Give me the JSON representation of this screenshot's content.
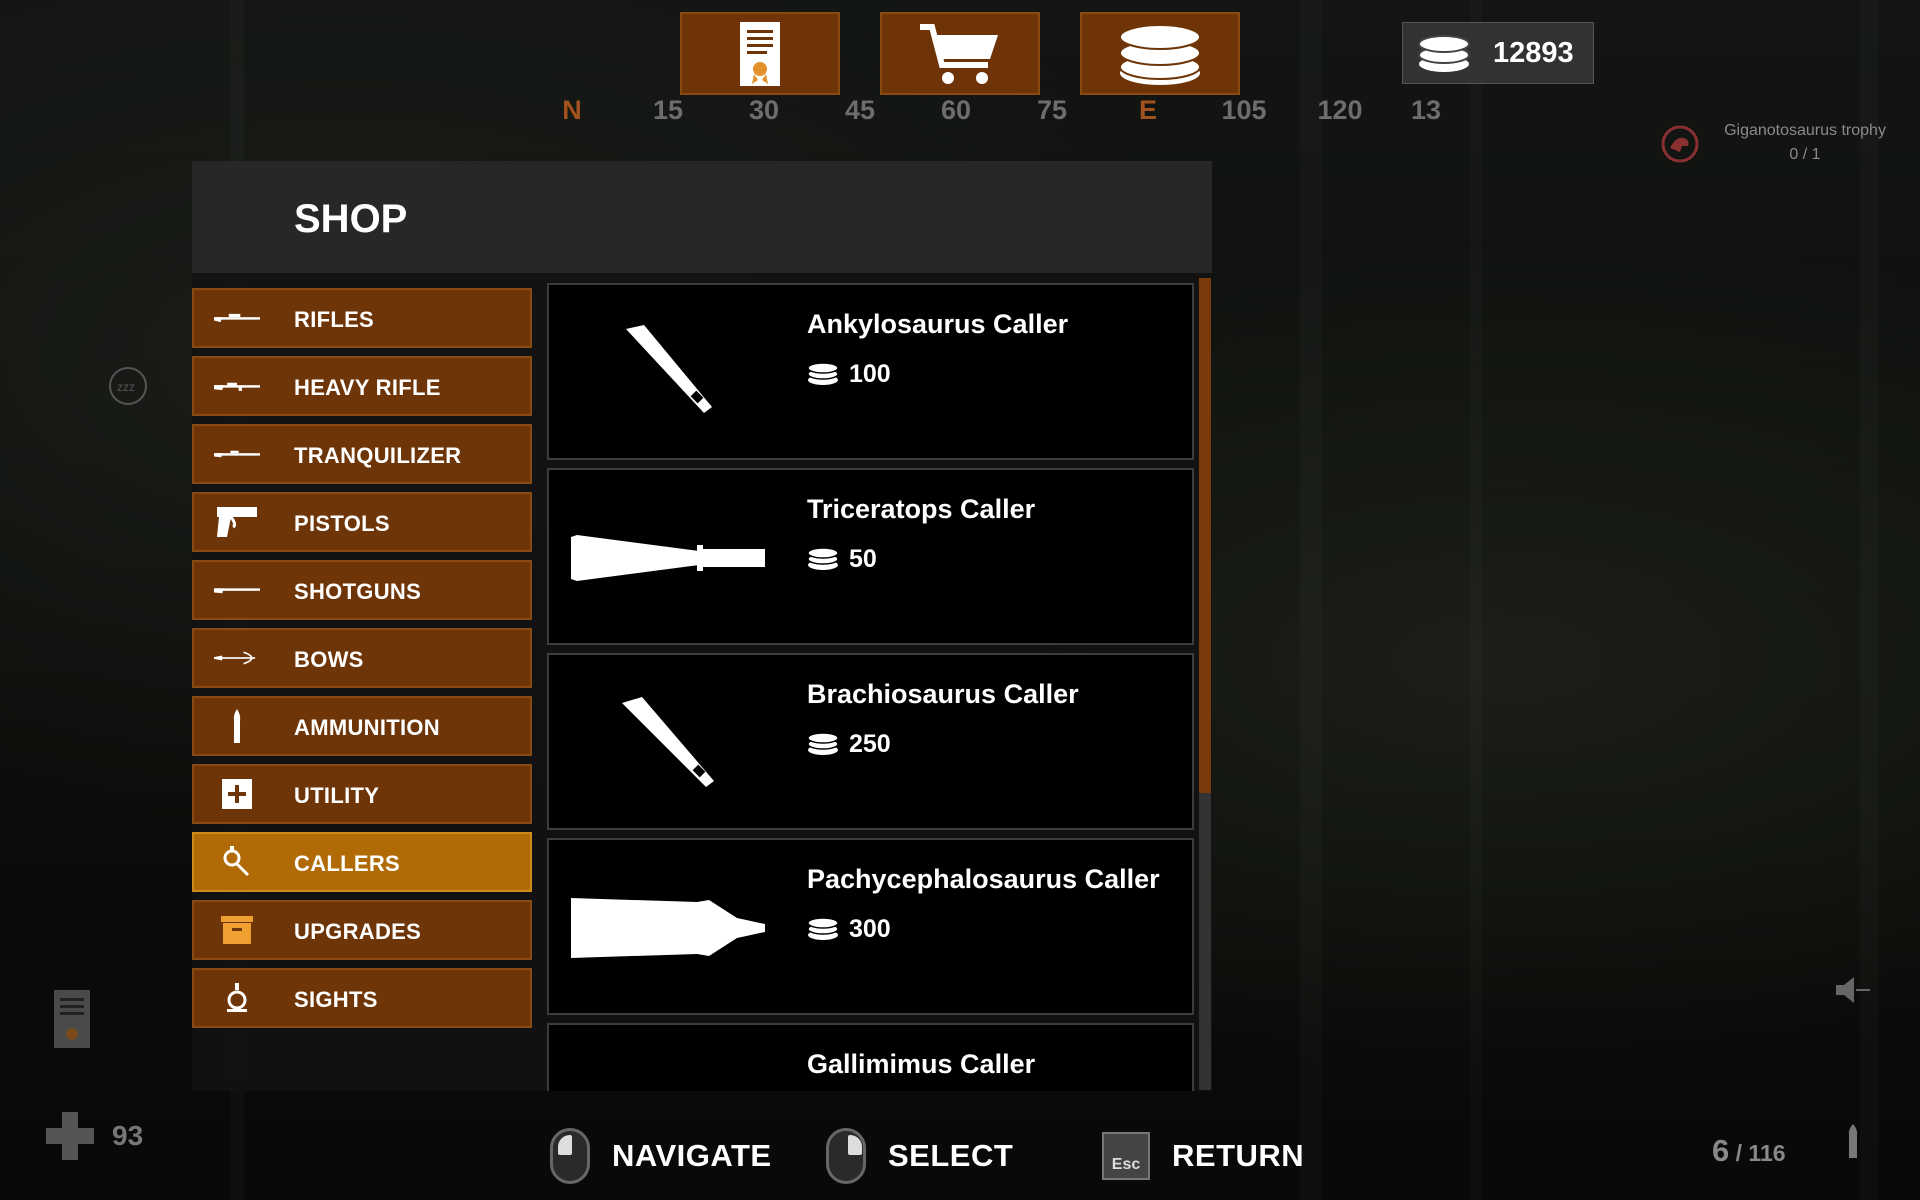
{
  "top_tabs": [
    {
      "name": "contracts",
      "icon": "contract-certificate-icon"
    },
    {
      "name": "shop",
      "icon": "shopping-cart-icon"
    },
    {
      "name": "currency",
      "icon": "coin-stack-icon"
    }
  ],
  "currency": {
    "icon": "coin-stack-icon",
    "value": "12893"
  },
  "compass": {
    "marks": [
      "N",
      "15",
      "30",
      "45",
      "60",
      "75",
      "E",
      "105",
      "120",
      "13"
    ]
  },
  "trophy": {
    "name": "Giganotosaurus trophy",
    "progress": "0 / 1"
  },
  "shop": {
    "title": "SHOP",
    "categories": [
      {
        "label": "RIFLES",
        "icon": "rifle-icon",
        "active": false
      },
      {
        "label": "HEAVY RIFLE",
        "icon": "heavy-rifle-icon",
        "active": false
      },
      {
        "label": "TRANQUILIZER",
        "icon": "tranquilizer-rifle-icon",
        "active": false
      },
      {
        "label": "PISTOLS",
        "icon": "pistol-icon",
        "active": false
      },
      {
        "label": "SHOTGUNS",
        "icon": "shotgun-icon",
        "active": false
      },
      {
        "label": "BOWS",
        "icon": "bow-icon",
        "active": false
      },
      {
        "label": "AMMUNITION",
        "icon": "bullet-icon",
        "active": false
      },
      {
        "label": "UTILITY",
        "icon": "medkit-plus-icon",
        "active": false
      },
      {
        "label": "CALLERS",
        "icon": "caller-horn-icon",
        "active": true
      },
      {
        "label": "UPGRADES",
        "icon": "upgrade-box-icon",
        "active": false
      },
      {
        "label": "SIGHTS",
        "icon": "scope-sight-icon",
        "active": false
      }
    ],
    "items": [
      {
        "name": "Ankylosaurus Caller",
        "price": "100",
        "art": "horn-caller-art"
      },
      {
        "name": "Triceratops Caller",
        "price": "50",
        "art": "long-horn-caller-art"
      },
      {
        "name": "Brachiosaurus Caller",
        "price": "250",
        "art": "horn-caller-art"
      },
      {
        "name": "Pachycephalosaurus Caller",
        "price": "300",
        "art": "tube-caller-art"
      },
      {
        "name": "Gallimimus Caller",
        "price": "",
        "art": ""
      }
    ]
  },
  "hints": [
    {
      "label": "NAVIGATE",
      "key": "mouse-left-icon"
    },
    {
      "label": "SELECT",
      "key": "mouse-right-icon"
    },
    {
      "label": "RETURN",
      "key": "Esc"
    }
  ],
  "hud": {
    "health": "93",
    "ammo_current": "6",
    "ammo_total": " / 116"
  },
  "colors": {
    "panel_orange": "#6e3608",
    "active_orange": "#b06b06",
    "compass_dir": "#a2521c"
  }
}
